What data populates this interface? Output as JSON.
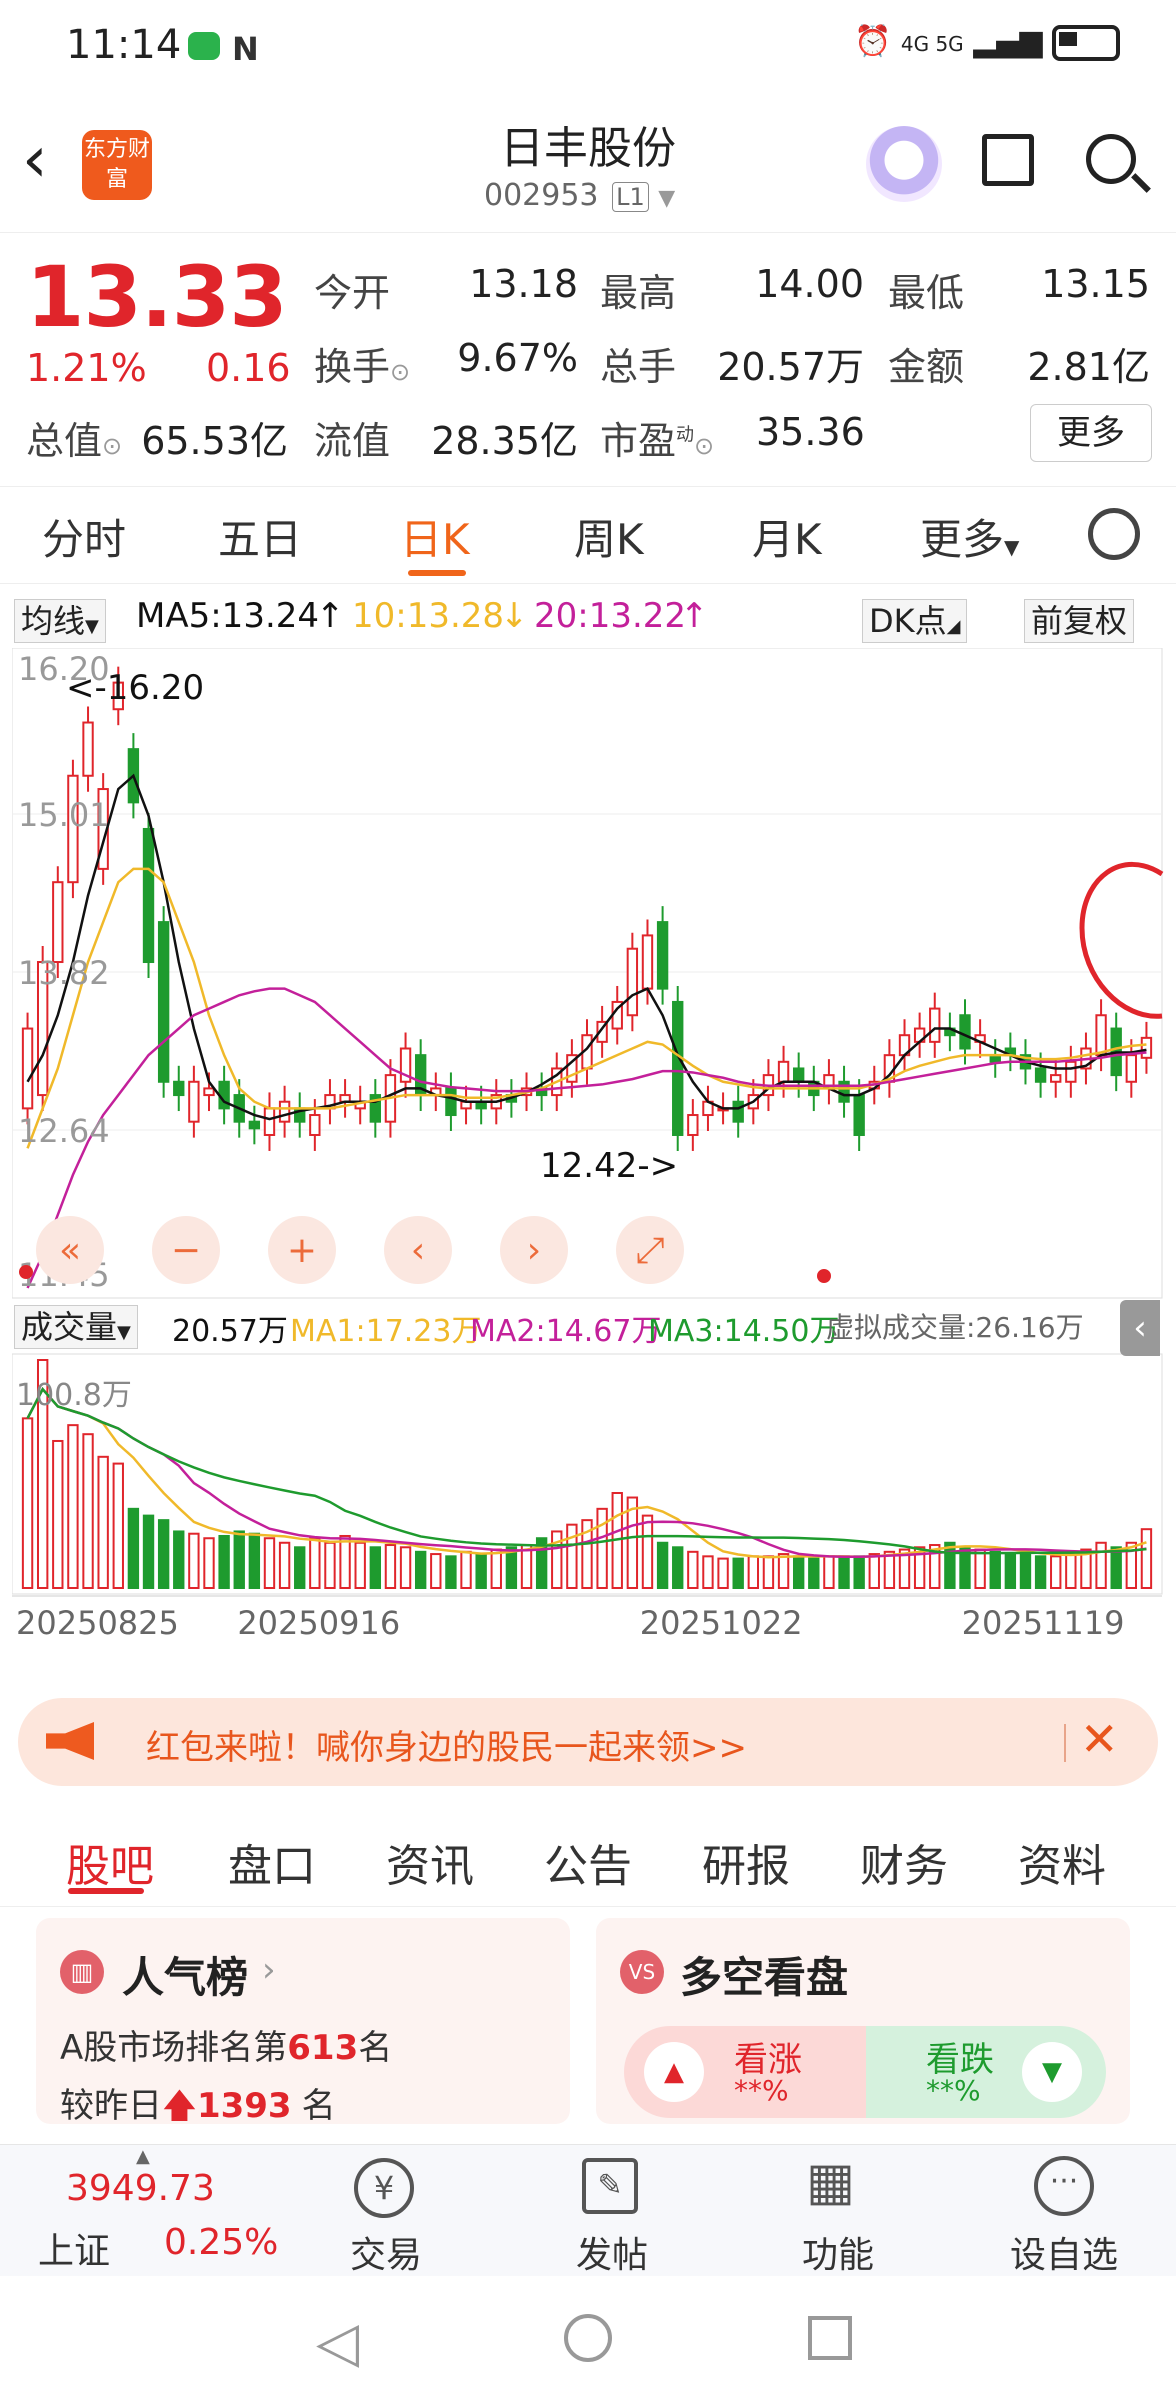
{
  "status": {
    "time": "11:14",
    "right": "4G 5G"
  },
  "header": {
    "logo": "东方财富",
    "title": "日丰股份",
    "code": "002953",
    "code_tag": "L1"
  },
  "quote": {
    "price": "13.33",
    "change_pct": "1.21%",
    "change": "0.16",
    "open_label": "今开",
    "open": "13.18",
    "high_label": "最高",
    "high": "14.00",
    "low_label": "最低",
    "low": "13.15",
    "turnover_label": "换手",
    "turnover": "9.67%",
    "volume_label": "总手",
    "volume": "20.57万",
    "amount_label": "金额",
    "amount": "2.81亿",
    "mcap_label": "总值",
    "mcap": "65.53亿",
    "float_label": "流值",
    "float": "28.35亿",
    "pe_label": "市盈",
    "pe_sup": "动",
    "pe": "35.36",
    "more": "更多"
  },
  "tabs": [
    "分时",
    "五日",
    "日K",
    "周K",
    "月K",
    "更多"
  ],
  "ma": {
    "selector": "均线",
    "ma5": "MA5:13.24",
    "ma10": "10:13.28",
    "ma20": "20:13.22",
    "dk": "DK点",
    "adjust": "前复权"
  },
  "price_axis": [
    "16.20",
    "15.01",
    "13.82",
    "12.64",
    "11.45"
  ],
  "annotations": {
    "high": "<-16.20",
    "low": "12.42->"
  },
  "volume_header": {
    "selector": "成交量",
    "vol": "20.57万",
    "ma1": "MA1:17.23万",
    "ma2": "MA2:14.67万",
    "ma3": "MA3:14.50万",
    "virtual": "虚拟成交量:26.16万",
    "max": "100.8万"
  },
  "dates": [
    "20250825",
    "20250916",
    "20251022",
    "20251119"
  ],
  "colors": {
    "up": "#e0252b",
    "down": "#1e9b2e",
    "ma5": "#111111",
    "ma10": "#f0b92a",
    "ma20": "#c3209a",
    "accent": "#f0651a"
  },
  "chart_data": {
    "type": "candlestick",
    "ylim": [
      11.45,
      16.2
    ],
    "x": [
      "20250825",
      "20250916",
      "20251022",
      "20251119"
    ],
    "open": [
      12.8,
      12.9,
      13.9,
      14.5,
      15.3,
      14.6,
      15.8,
      15.5,
      14.9,
      14.2,
      13.0,
      12.7,
      12.9,
      13.0,
      12.9,
      12.7,
      12.6,
      12.7,
      12.8,
      12.6,
      12.8,
      12.85,
      12.8,
      12.9,
      12.7,
      13.0,
      13.2,
      12.9,
      12.95,
      12.8,
      12.85,
      12.8,
      12.9,
      12.9,
      12.95,
      12.9,
      13.0,
      13.1,
      13.3,
      13.4,
      13.5,
      13.7,
      14.2,
      13.6,
      12.6,
      12.75,
      12.8,
      12.85,
      12.8,
      12.9,
      13.0,
      13.1,
      13.0,
      12.95,
      13.0,
      12.9,
      12.95,
      13.0,
      13.2,
      13.3,
      13.3,
      13.4,
      13.5,
      13.3,
      13.2,
      13.25,
      13.2,
      13.1,
      13.0,
      13.0,
      13.1,
      13.2,
      13.4,
      13.0,
      13.18
    ],
    "close": [
      13.4,
      13.9,
      14.5,
      15.3,
      15.7,
      15.2,
      16.0,
      15.1,
      13.9,
      13.0,
      12.9,
      13.0,
      12.95,
      12.8,
      12.7,
      12.65,
      12.8,
      12.85,
      12.7,
      12.75,
      12.9,
      12.9,
      12.85,
      12.7,
      13.05,
      13.25,
      12.9,
      12.95,
      12.75,
      12.85,
      12.8,
      12.9,
      12.85,
      12.95,
      12.9,
      13.1,
      13.2,
      13.35,
      13.45,
      13.6,
      14.0,
      14.1,
      13.7,
      12.6,
      12.75,
      12.85,
      12.8,
      12.7,
      12.9,
      13.05,
      13.15,
      13.0,
      12.9,
      13.05,
      12.85,
      12.6,
      13.0,
      13.2,
      13.35,
      13.4,
      13.55,
      13.35,
      13.25,
      13.35,
      13.15,
      13.2,
      13.1,
      13.0,
      13.05,
      13.15,
      13.25,
      13.5,
      13.05,
      13.2,
      13.33
    ],
    "ma5": [
      13.0,
      13.2,
      13.5,
      13.9,
      14.4,
      14.8,
      15.2,
      15.3,
      15.0,
      14.5,
      13.9,
      13.4,
      13.0,
      12.85,
      12.8,
      12.75,
      12.72,
      12.75,
      12.78,
      12.8,
      12.82,
      12.85,
      12.85,
      12.85,
      12.9,
      12.95,
      12.95,
      12.9,
      12.88,
      12.85,
      12.85,
      12.85,
      12.88,
      12.92,
      12.98,
      13.05,
      13.15,
      13.25,
      13.4,
      13.55,
      13.65,
      13.7,
      13.5,
      13.2,
      13.0,
      12.85,
      12.8,
      12.8,
      12.85,
      12.95,
      13.0,
      13.0,
      13.0,
      12.95,
      12.9,
      12.9,
      12.95,
      13.05,
      13.2,
      13.3,
      13.4,
      13.4,
      13.35,
      13.3,
      13.25,
      13.2,
      13.15,
      13.12,
      13.1,
      13.1,
      13.12,
      13.2,
      13.22,
      13.22,
      13.24
    ],
    "ma10": [
      12.5,
      12.8,
      13.1,
      13.5,
      13.9,
      14.2,
      14.5,
      14.6,
      14.6,
      14.5,
      14.2,
      13.9,
      13.5,
      13.2,
      12.95,
      12.85,
      12.8,
      12.8,
      12.8,
      12.8,
      12.8,
      12.82,
      12.84,
      12.86,
      12.88,
      12.9,
      12.9,
      12.9,
      12.9,
      12.88,
      12.88,
      12.88,
      12.9,
      12.92,
      12.95,
      13.0,
      13.05,
      13.1,
      13.15,
      13.2,
      13.25,
      13.3,
      13.28,
      13.2,
      13.12,
      13.05,
      13.0,
      12.98,
      12.96,
      12.95,
      12.95,
      12.95,
      12.95,
      12.95,
      12.95,
      12.95,
      12.98,
      13.02,
      13.08,
      13.12,
      13.15,
      13.18,
      13.2,
      13.2,
      13.2,
      13.2,
      13.18,
      13.17,
      13.17,
      13.18,
      13.2,
      13.22,
      13.25,
      13.27,
      13.28
    ],
    "ma20": [
      11.45,
      11.7,
      12.0,
      12.3,
      12.55,
      12.75,
      12.9,
      13.05,
      13.2,
      13.3,
      13.4,
      13.5,
      13.55,
      13.6,
      13.65,
      13.68,
      13.7,
      13.7,
      13.65,
      13.6,
      13.5,
      13.4,
      13.3,
      13.2,
      13.1,
      13.05,
      13.0,
      12.98,
      12.96,
      12.95,
      12.94,
      12.93,
      12.93,
      12.93,
      12.94,
      12.95,
      12.96,
      12.97,
      12.98,
      13.0,
      13.02,
      13.05,
      13.08,
      13.08,
      13.07,
      13.05,
      13.03,
      13.0,
      12.98,
      12.97,
      12.97,
      12.97,
      12.97,
      12.97,
      12.97,
      12.97,
      12.98,
      13.0,
      13.02,
      13.04,
      13.06,
      13.08,
      13.1,
      13.12,
      13.14,
      13.15,
      13.15,
      13.15,
      13.15,
      13.16,
      13.17,
      13.18,
      13.2,
      13.21,
      13.22
    ],
    "volume_ylim": [
      0,
      100.8
    ],
    "volume": [
      75,
      100.8,
      65,
      72,
      68,
      58,
      55,
      35,
      32,
      30,
      25,
      24,
      22,
      23,
      25,
      24,
      22,
      20,
      18,
      22,
      20,
      23,
      20,
      18,
      19,
      18,
      16,
      15,
      14,
      16,
      15,
      17,
      18,
      19,
      22,
      25,
      28,
      30,
      35,
      42,
      40,
      32,
      20,
      18,
      16,
      14,
      13,
      13,
      14,
      14,
      15,
      14,
      13,
      14,
      14,
      14,
      15,
      16,
      17,
      18,
      19,
      20,
      18,
      17,
      16,
      15,
      15,
      14,
      14,
      15,
      17,
      20,
      18,
      20,
      26
    ]
  },
  "promo": {
    "text": "红包来啦！喊你身边的股民一起来领>>"
  },
  "bottom_tabs": [
    "股吧",
    "盘口",
    "资讯",
    "公告",
    "研报",
    "财务",
    "资料"
  ],
  "popularity": {
    "title": "人气榜",
    "line1_prefix": "A股市场排名第",
    "rank": "613",
    "line1_suffix": "名",
    "line2_prefix": "较昨日",
    "delta": "1393",
    "line2_suffix": "名"
  },
  "vote": {
    "title": "多空看盘",
    "up_label": "看涨",
    "up_pct": "**%",
    "down_label": "看跌",
    "down_pct": "**%"
  },
  "index": {
    "value": "3949.73",
    "name": "上证",
    "pct": "0.25%"
  },
  "nav": {
    "trade": "交易",
    "post": "发帖",
    "features": "功能",
    "watchlist": "设自选"
  }
}
